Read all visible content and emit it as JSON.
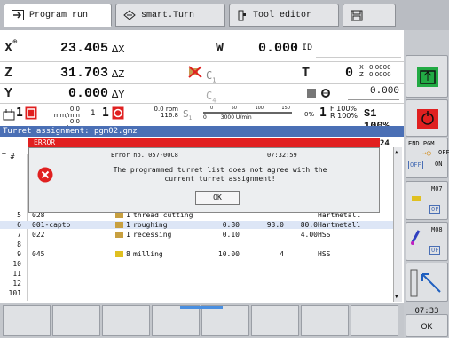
{
  "tabs": {
    "program_run": "Program run",
    "smart_turn": "smart.Turn",
    "tool_editor": "Tool editor"
  },
  "positions": {
    "x": {
      "axis": "X",
      "value": "23.405",
      "delta": "ΔX"
    },
    "z": {
      "axis": "Z",
      "value": "31.703",
      "delta": "ΔZ"
    },
    "y": {
      "axis": "Y",
      "value": "0.000",
      "delta": "ΔY"
    },
    "w": {
      "axis": "W",
      "value": "0.000",
      "id": "ID"
    },
    "c1": "C",
    "c4": "C",
    "c1_sub": "1",
    "c4_sub": "4",
    "t": {
      "label": "T",
      "value": "0",
      "x_label": "X",
      "x_value": "0.0000",
      "z_label": "Z",
      "z_value": "0.0000"
    },
    "extra": "0.000"
  },
  "feed": {
    "override_num": "1",
    "feed_line1": "0.0 mm/min",
    "feed_line2": "0.0 mm/min",
    "s1": "1",
    "s_num": "1",
    "rpm": "0.0 rpm",
    "rpm2": "116.8",
    "s_label": "S",
    "s_sub": "1",
    "scale_ticks": [
      "0",
      "50",
      "100",
      "150"
    ],
    "scale_vals": [
      "0",
      "3000 U/min"
    ],
    "zero_label": "0%",
    "f_label": "F 100%",
    "r_label": "R 100%",
    "s_percent": "S1 100%",
    "one": "1"
  },
  "turret": {
    "header": "Turret assignment: pgm02.gmz",
    "col_t": "T #",
    "count": "24"
  },
  "error": {
    "title": "ERROR",
    "number": "Error no. 057-00C8",
    "time": "07:32:59",
    "line1": "The programmed turret list does not agree with the",
    "line2": "current turret assignment!",
    "ok": "OK"
  },
  "rows": [
    {
      "n": "5",
      "id": "028",
      "q": "1",
      "name": "thread cutting",
      "r": "",
      "a": "",
      "b": "",
      "mat": "Hartmetall"
    },
    {
      "n": "6",
      "id": "001-capto",
      "q": "1",
      "name": "roughing",
      "r": "0.80",
      "a": "93.0",
      "b": "80.0",
      "mat": "Hartmetall"
    },
    {
      "n": "7",
      "id": "022",
      "q": "1",
      "name": "recessing",
      "r": "0.10",
      "a": "",
      "b": "4.00",
      "mat": "HSS"
    },
    {
      "n": "8",
      "id": "",
      "q": "",
      "name": "",
      "r": "",
      "a": "",
      "b": "",
      "mat": ""
    },
    {
      "n": "9",
      "id": "045",
      "q": "8",
      "name": "milling",
      "r": "10.00",
      "a": "4",
      "b": "",
      "mat": "HSS"
    },
    {
      "n": "10",
      "id": "",
      "q": "",
      "name": "",
      "r": "",
      "a": "",
      "b": "",
      "mat": ""
    },
    {
      "n": "11",
      "id": "",
      "q": "",
      "name": "",
      "r": "",
      "a": "",
      "b": "",
      "mat": ""
    },
    {
      "n": "12",
      "id": "",
      "q": "",
      "name": "",
      "r": "",
      "a": "",
      "b": "",
      "mat": ""
    },
    {
      "n": "101",
      "id": "",
      "q": "",
      "name": "",
      "r": "",
      "a": "",
      "b": "",
      "mat": ""
    }
  ],
  "right": {
    "end_pgm": "END PGM",
    "off": "OFF",
    "on": "ON",
    "off2": "OF",
    "m07": "M07",
    "off3": "OF",
    "m08": "M08",
    "off4": "OF",
    "clock": "07:33",
    "ok": "OK"
  },
  "colors": {
    "tab_bg": "#b9bcc2",
    "header_blue": "#4a6fb5",
    "error_red": "#e12020",
    "green": "#22aa44"
  }
}
